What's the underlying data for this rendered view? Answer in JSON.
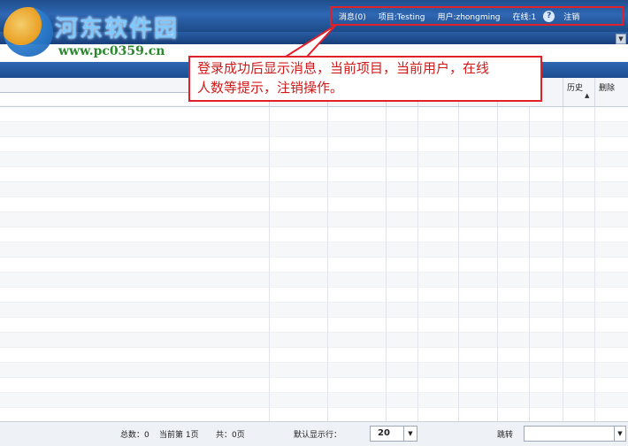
{
  "logo": {
    "title": "河东软件园",
    "url": "www.pc0359.cn",
    "mark_icon": "logo-mark-icon"
  },
  "header": {
    "messages": "消息(0)",
    "project": "项目:Testing",
    "user": "用户:zhongming",
    "online": "在线:1",
    "help_icon": "?",
    "logout": "注销"
  },
  "grid": {
    "columns": [
      {
        "label": ""
      },
      {
        "label": ""
      },
      {
        "label": ""
      },
      {
        "label": ""
      },
      {
        "label": ""
      },
      {
        "label": ""
      },
      {
        "label": ""
      },
      {
        "label": "历史"
      },
      {
        "label": "删除"
      }
    ]
  },
  "callout": {
    "line1": "登录成功后显示消息，当前项目，当前用户，在线",
    "line2": "人数等提示，注销操作。"
  },
  "footer": {
    "total": "总数：0",
    "current_page": "当前第  1页",
    "page_count": "共：0页",
    "default_rows_label": "默认显示行：",
    "default_rows_value": "20",
    "jump_label": "跳转"
  },
  "colors": {
    "banner": "#2f67b3",
    "highlight": "#e0212b"
  }
}
